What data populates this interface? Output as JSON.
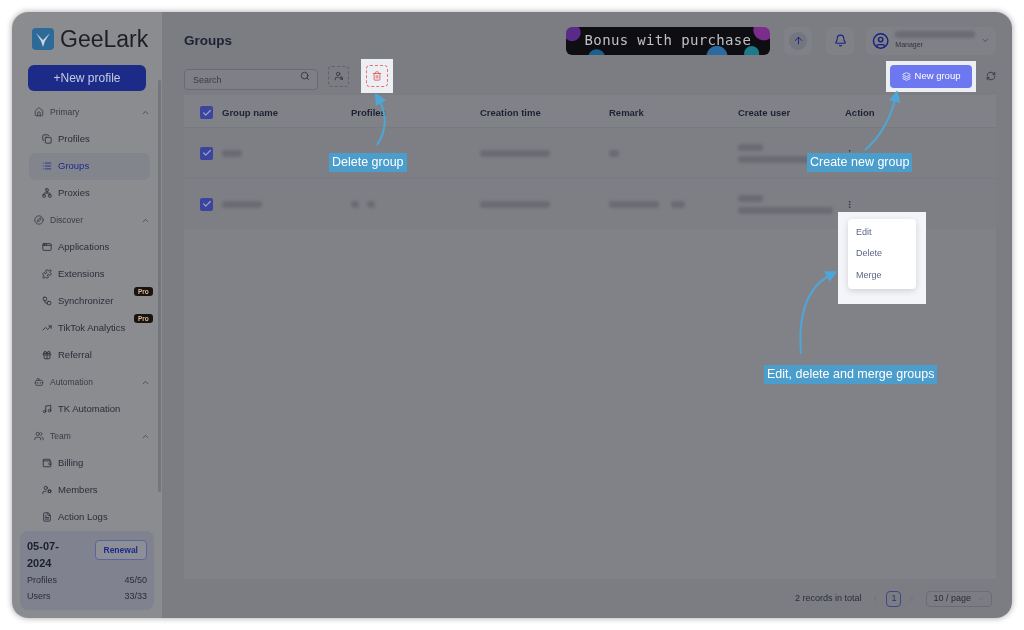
{
  "sidebar": {
    "logo": "GeeLark",
    "new_profile": "+New profile",
    "sections": [
      {
        "title": "Primary",
        "expanded": true,
        "items": [
          {
            "label": "Profiles",
            "selected": false
          },
          {
            "label": "Groups",
            "selected": true
          },
          {
            "label": "Proxies",
            "selected": false
          }
        ]
      },
      {
        "title": "Discover",
        "expanded": true,
        "items": [
          {
            "label": "Applications",
            "selected": false
          },
          {
            "label": "Extensions",
            "selected": false
          },
          {
            "label": "Synchronizer",
            "selected": false,
            "badge": "Pro"
          },
          {
            "label": "TikTok Analytics",
            "selected": false,
            "badge": "Pro"
          },
          {
            "label": "Referral",
            "selected": false
          }
        ]
      },
      {
        "title": "Automation",
        "expanded": true,
        "items": [
          {
            "label": "TK Automation",
            "selected": false
          }
        ]
      },
      {
        "title": "Team",
        "expanded": true,
        "items": [
          {
            "label": "Billing",
            "selected": false
          },
          {
            "label": "Members",
            "selected": false
          },
          {
            "label": "Action Logs",
            "selected": false
          }
        ]
      }
    ],
    "plan": {
      "date": "05-07-2024",
      "renewal": "Renewal",
      "stats": [
        {
          "label": "Profiles",
          "value": "45/50"
        },
        {
          "label": "Users",
          "value": "33/33"
        }
      ]
    }
  },
  "header": {
    "title": "Groups",
    "banner": "Bonus with purchase",
    "user_role": "Manager"
  },
  "toolbar": {
    "search_placeholder": "Search",
    "new_group": "New group"
  },
  "table": {
    "all_checked": true,
    "columns": [
      "Group name",
      "Profiles",
      "Creation time",
      "Remark",
      "Create user",
      "Action"
    ],
    "rows": [
      {
        "checked": true
      },
      {
        "checked": true
      }
    ]
  },
  "row_menu": [
    "Edit",
    "Delete",
    "Merge"
  ],
  "pagination": {
    "total": "2 records in total",
    "page": "1",
    "page_size": "10 / page"
  },
  "annotations": [
    {
      "text": "Delete group"
    },
    {
      "text": "Create new group"
    },
    {
      "text": "Edit, delete and merge groups"
    }
  ]
}
